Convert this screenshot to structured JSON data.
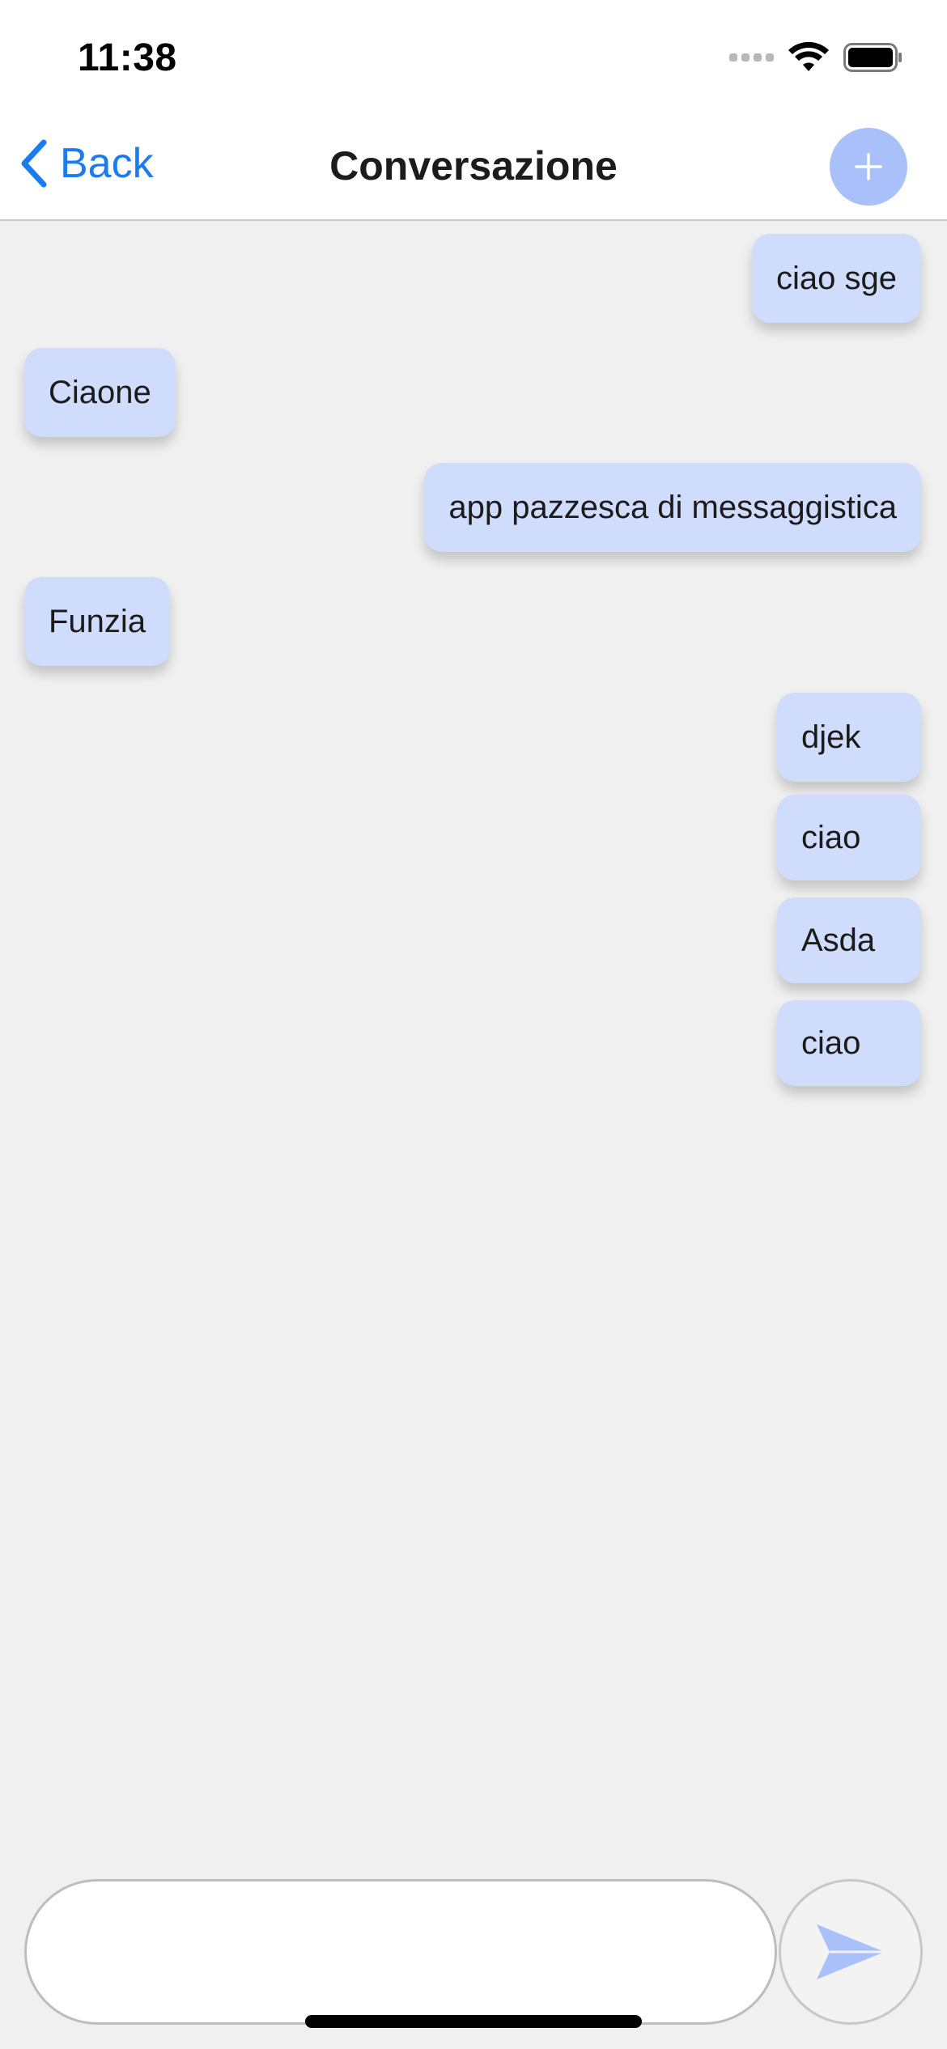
{
  "status_bar": {
    "time": "11:38",
    "icons": [
      "signal-icon",
      "wifi-icon",
      "battery-icon"
    ]
  },
  "nav": {
    "back_label": "Back",
    "title": "Conversazione",
    "add_icon": "plus-icon"
  },
  "messages": [
    {
      "text": "ciao sge",
      "side": "sent"
    },
    {
      "text": "Ciaone",
      "side": "received"
    },
    {
      "text": "app pazzesca di messaggistica",
      "side": "sent"
    },
    {
      "text": "Funzia",
      "side": "received"
    },
    {
      "text": "djek",
      "side": "sent"
    },
    {
      "text": "ciao",
      "side": "sent"
    },
    {
      "text": "Asda",
      "side": "sent"
    },
    {
      "text": "ciao",
      "side": "sent"
    }
  ],
  "composer": {
    "value": "",
    "placeholder": "",
    "send_icon": "send-icon"
  },
  "colors": {
    "accent": "#1a7cf0",
    "bubble": "#cfdcfc",
    "button": "#a9c0fb",
    "background": "#f0f0f0"
  }
}
